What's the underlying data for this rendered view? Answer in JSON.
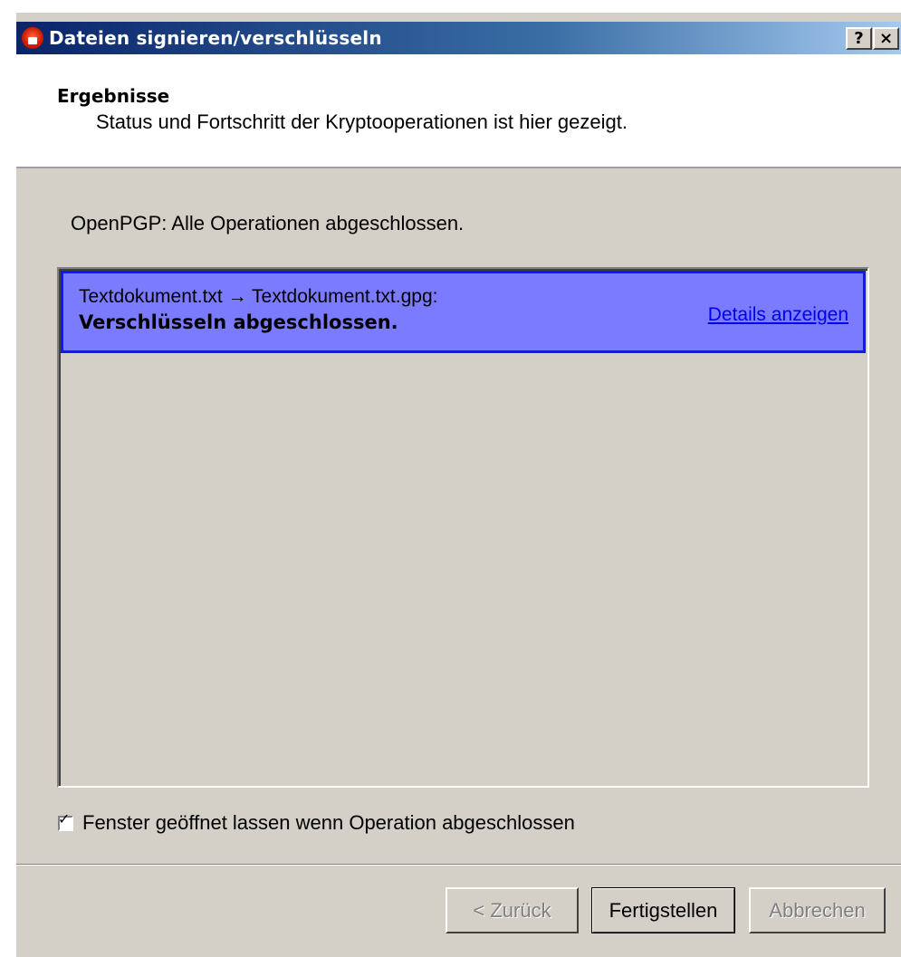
{
  "window": {
    "title": "Dateien signieren/verschlüsseln",
    "help_label": "?",
    "close_label": "×"
  },
  "header": {
    "title": "Ergebnisse",
    "subtitle": "Status und Fortschritt der Kryptooperationen ist hier gezeigt."
  },
  "status": {
    "text": "OpenPGP: Alle Operationen abgeschlossen."
  },
  "results": [
    {
      "line1": "Textdokument.txt → Textdokument.txt.gpg:",
      "line2": "Verschlüsseln abgeschlossen.",
      "link": "Details anzeigen",
      "highlight_color": "#7b7bff"
    }
  ],
  "options": {
    "keep_open_label": "Fenster geöffnet lassen wenn Operation abgeschlossen",
    "keep_open_checked": true
  },
  "buttons": {
    "back": "< Zurück",
    "finish": "Fertigstellen",
    "cancel": "Abbrechen"
  }
}
